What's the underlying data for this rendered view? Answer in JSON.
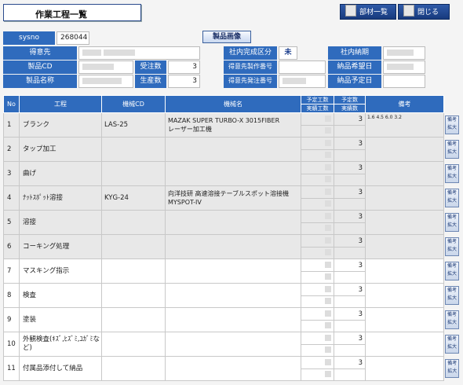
{
  "header": {
    "title": "作業工程一覧",
    "buttons": [
      {
        "label": "部材一覧"
      },
      {
        "label": "閉じる"
      }
    ]
  },
  "info": {
    "sysno_label": "sysno",
    "sysno_value": "268044",
    "product_image_button": "製品画像",
    "customer_label": "得意先",
    "product_cd_label": "製品CD",
    "product_name_label": "製品名称",
    "order_qty_label": "受注数",
    "order_qty_value": "3",
    "prod_qty_label": "生産数",
    "prod_qty_value": "3",
    "inhouse_complete_label": "社内完成区分",
    "inhouse_complete_value": "未",
    "customer_mfg_no_label": "得意先製作番号",
    "customer_order_no_label": "得意先発注番号",
    "inhouse_delivery_label": "社内納期",
    "delivery_wish_label": "納品希望日",
    "delivery_plan_label": "納品予定日"
  },
  "table": {
    "headers": {
      "no": "No",
      "process": "工程",
      "machine_cd": "機械CD",
      "machine_name": "機械名",
      "planned_hours": "予定工数",
      "actual_hours": "実績工数",
      "planned_qty": "予定数",
      "actual_qty": "実績数",
      "remarks": "備考"
    },
    "remark_button": "備考\n拡大",
    "rows": [
      {
        "no": "1",
        "process": "ブランク",
        "machine_cd": "LAS-25",
        "machine_name": "MAZAK SUPER TURBO-X 3015FIBER\nレーザー加工機",
        "planned_qty": "3",
        "remarks": "1.6 4.5 6.0 3.2",
        "shade": "gray"
      },
      {
        "no": "2",
        "process": "タップ加工",
        "machine_cd": "",
        "machine_name": "",
        "planned_qty": "3",
        "remarks": "",
        "shade": "gray"
      },
      {
        "no": "3",
        "process": "曲げ",
        "machine_cd": "",
        "machine_name": "",
        "planned_qty": "3",
        "remarks": "",
        "shade": "gray"
      },
      {
        "no": "4",
        "process": "ﾅｯﾄｽﾎﾟｯﾄ溶接",
        "machine_cd": "KYG-24",
        "machine_name": "向洋技研 高速溶接テーブルスポット溶接機 MYSPOT-IV",
        "planned_qty": "3",
        "remarks": "",
        "shade": "gray"
      },
      {
        "no": "5",
        "process": "溶接",
        "machine_cd": "",
        "machine_name": "",
        "planned_qty": "3",
        "remarks": "",
        "shade": "gray"
      },
      {
        "no": "6",
        "process": "コーキング処理",
        "machine_cd": "",
        "machine_name": "",
        "planned_qty": "3",
        "remarks": "",
        "shade": "gray"
      },
      {
        "no": "7",
        "process": "マスキング指示",
        "machine_cd": "",
        "machine_name": "",
        "planned_qty": "3",
        "remarks": "",
        "shade": "white"
      },
      {
        "no": "8",
        "process": "検査",
        "machine_cd": "",
        "machine_name": "",
        "planned_qty": "3",
        "remarks": "",
        "shade": "white"
      },
      {
        "no": "9",
        "process": "塗装",
        "machine_cd": "",
        "machine_name": "",
        "planned_qty": "3",
        "remarks": "",
        "shade": "white"
      },
      {
        "no": "10",
        "process": "外観検査(ｷｽﾞ,ﾋｽﾞﾐ,ﾕｶﾞﾐなど)",
        "machine_cd": "",
        "machine_name": "",
        "planned_qty": "3",
        "remarks": "",
        "shade": "white"
      },
      {
        "no": "11",
        "process": "付属品添付して納品",
        "machine_cd": "",
        "machine_name": "",
        "planned_qty": "3",
        "remarks": "",
        "shade": "white"
      }
    ]
  }
}
